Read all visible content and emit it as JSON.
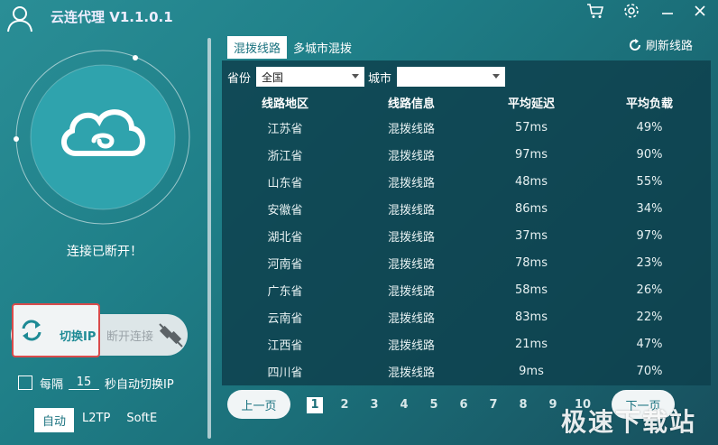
{
  "title": "云连代理 V1.1.0.1",
  "status": "连接已断开！",
  "left": {
    "switch_label": "切换IP",
    "disconnect_label": "断开连接",
    "auto_prefix": "每隔",
    "auto_interval": "15",
    "auto_suffix": "秒自动切换IP",
    "modes": [
      "自动",
      "L2TP",
      "SoftE"
    ]
  },
  "tabs": [
    "混拨线路",
    "多城市混拨"
  ],
  "refresh_label": "刷新线路",
  "filter": {
    "province_label": "省份",
    "province_value": "全国",
    "city_label": "城市",
    "city_value": ""
  },
  "table": {
    "headers": [
      "线路地区",
      "线路信息",
      "平均延迟",
      "平均负载"
    ],
    "rows": [
      [
        "江苏省",
        "混拨线路",
        "57ms",
        "49%"
      ],
      [
        "浙江省",
        "混拨线路",
        "97ms",
        "90%"
      ],
      [
        "山东省",
        "混拨线路",
        "48ms",
        "55%"
      ],
      [
        "安徽省",
        "混拨线路",
        "86ms",
        "34%"
      ],
      [
        "湖北省",
        "混拨线路",
        "37ms",
        "97%"
      ],
      [
        "河南省",
        "混拨线路",
        "78ms",
        "23%"
      ],
      [
        "广东省",
        "混拨线路",
        "58ms",
        "26%"
      ],
      [
        "云南省",
        "混拨线路",
        "83ms",
        "22%"
      ],
      [
        "江西省",
        "混拨线路",
        "21ms",
        "47%"
      ],
      [
        "四川省",
        "混拨线路",
        "9ms",
        "70%"
      ]
    ]
  },
  "pagination": {
    "prev": "上一页",
    "next": "下一页",
    "pages": [
      "1",
      "2",
      "3",
      "4",
      "5",
      "6",
      "7",
      "8",
      "9",
      "10"
    ],
    "current": "1"
  },
  "watermark": "极速下载站",
  "colors": {
    "accent": "#1b7380",
    "highlight_border": "#d94b4b"
  }
}
